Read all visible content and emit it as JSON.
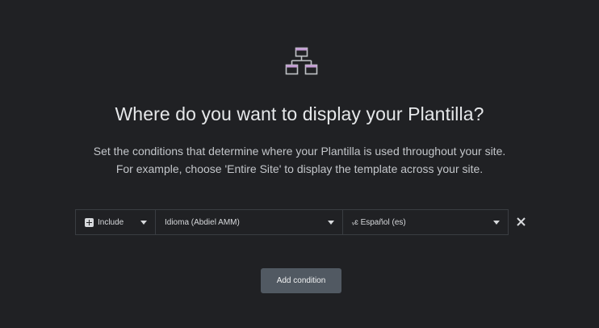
{
  "header": {
    "icon": "sitemap-icon",
    "title": "Where do you want to display your Plantilla?",
    "description_line1": "Set the conditions that determine where your Plantilla is used throughout your site.",
    "description_line2": "For example, choose 'Entire Site' to display the template across your site."
  },
  "condition": {
    "type": "Include",
    "type_icon": "plus-square-icon",
    "name": "Idioma (Abdiel AMM)",
    "value": "ᵥɛ Español (es)",
    "remove_icon": "close-icon"
  },
  "actions": {
    "add_condition_label": "Add condition"
  },
  "colors": {
    "background": "#202124",
    "accent": "#c39bd3",
    "button": "#515962"
  }
}
